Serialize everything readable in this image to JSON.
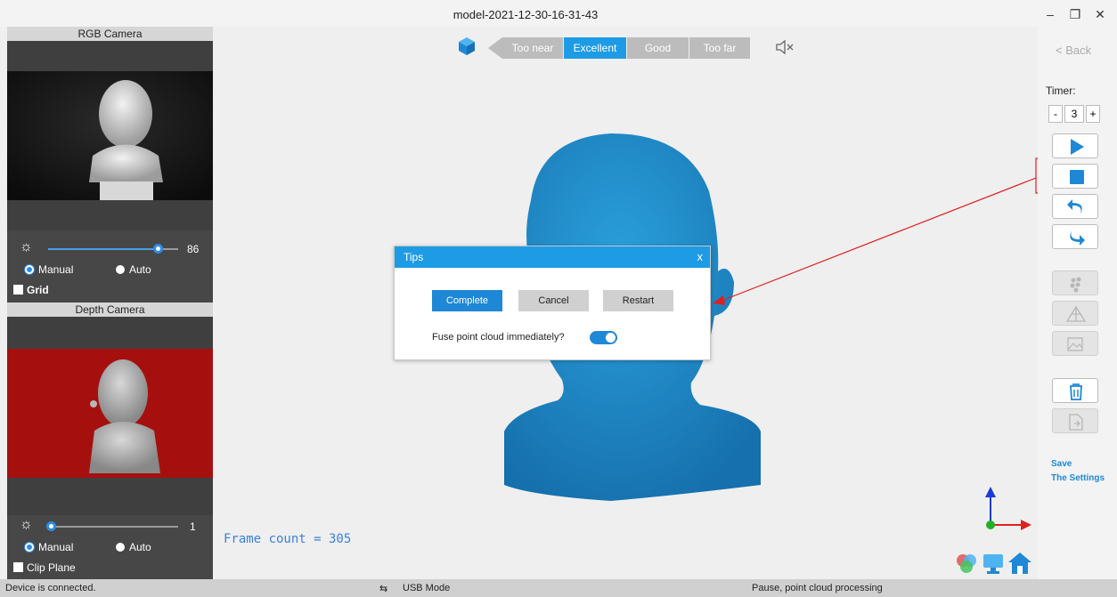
{
  "window": {
    "title": "model-2021-12-30-16-31-43",
    "minimize": "–",
    "maximize": "❐",
    "close": "✕"
  },
  "left_panel": {
    "rgb": {
      "title": "RGB Camera",
      "brightness_value": "86",
      "brightness_level": 0.86,
      "mode_manual": "Manual",
      "mode_auto": "Auto",
      "selected_mode": "Manual",
      "grid_label": "Grid",
      "grid_checked": false
    },
    "depth": {
      "title": "Depth Camera",
      "exposure_value": "1",
      "exposure_level": 0.01,
      "mode_manual": "Manual",
      "mode_auto": "Auto",
      "selected_mode": "Manual",
      "clip_plane_label": "Clip Plane",
      "clip_plane_checked": false
    }
  },
  "viewport": {
    "distance_indicator": {
      "items": [
        "Too near",
        "Excellent",
        "Good",
        "Too far"
      ],
      "active": "Excellent"
    },
    "frame_count": "Frame count = 305",
    "model_color": "#1e87c8"
  },
  "dialog": {
    "title": "Tips",
    "close": "x",
    "buttons": {
      "complete": "Complete",
      "cancel": "Cancel",
      "restart": "Restart"
    },
    "fuse_label": "Fuse point cloud immediately?",
    "fuse_enabled": true
  },
  "right_panel": {
    "back": "< Back",
    "timer_label": "Timer:",
    "timer_minus": "-",
    "timer_value": "3",
    "timer_plus": "+",
    "save_settings_line1": "Save",
    "save_settings_line2": "The Settings"
  },
  "statusbar": {
    "connection": "Device is connected.",
    "mode": "USB Mode",
    "status": "Pause, point cloud processing"
  },
  "colors": {
    "accent": "#1e9be5",
    "depth_bg": "#a5100f",
    "axis_x": "#e02020",
    "axis_y": "#1a3ad6",
    "axis_z": "#22b022"
  }
}
